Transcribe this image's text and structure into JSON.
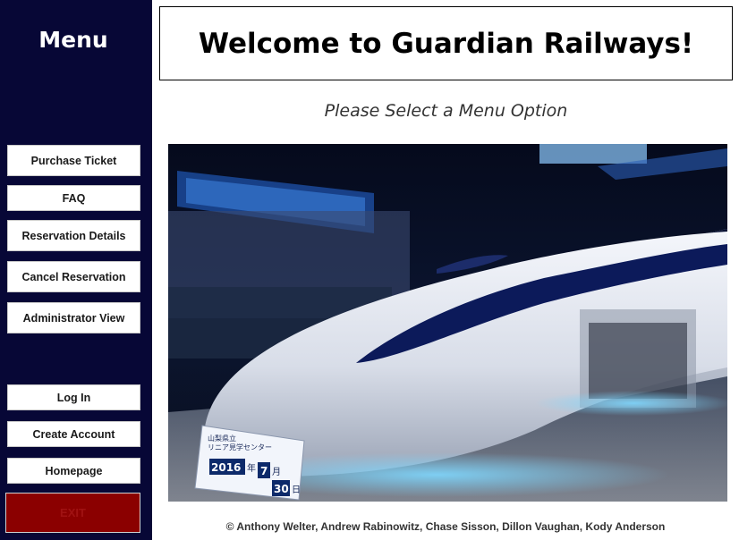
{
  "sidebar": {
    "title": "Menu",
    "buttons": [
      {
        "label": "Purchase Ticket"
      },
      {
        "label": "FAQ"
      },
      {
        "label": "Reservation Details"
      },
      {
        "label": "Cancel Reservation"
      },
      {
        "label": "Administrator View"
      },
      {
        "label": "Log In"
      },
      {
        "label": "Create Account"
      },
      {
        "label": "Homepage"
      }
    ],
    "exit_label": "EXIT"
  },
  "header": {
    "title": "Welcome to Guardian Railways!",
    "subtitle": "Please Select a Menu Option"
  },
  "photo": {
    "plaque": {
      "line1": "山梨県立",
      "line2": "リニア見学センター",
      "date_year": "2016",
      "date_year_suffix": "年",
      "date_month": "7",
      "date_month_suffix": "月",
      "date_day": "30",
      "date_day_suffix": "日"
    }
  },
  "footer": {
    "credits": "© Anthony Welter, Andrew Rabinowitz, Chase Sisson, Dillon Vaughan, Kody Anderson"
  },
  "colors": {
    "sidebar_bg": "#070736",
    "exit_bg": "#8b0000",
    "button_bg": "#ffffff"
  }
}
